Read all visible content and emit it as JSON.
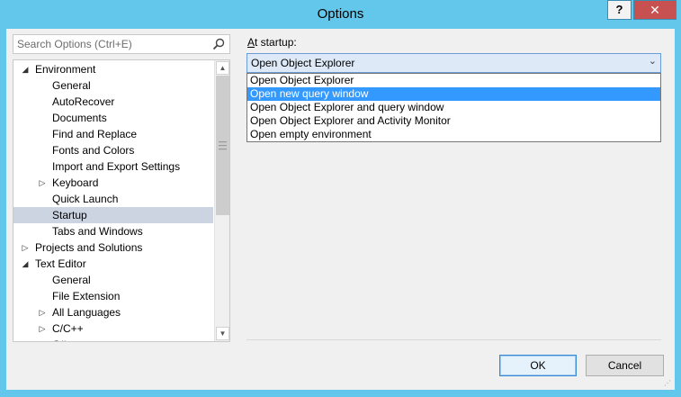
{
  "window": {
    "title": "Options",
    "help_label": "?",
    "close_label": "✕"
  },
  "search": {
    "placeholder": "Search Options (Ctrl+E)",
    "icon": "search-icon"
  },
  "tree": {
    "items": [
      {
        "label": "Environment",
        "indent": 0,
        "expander": "expanded"
      },
      {
        "label": "General",
        "indent": 1,
        "expander": "none"
      },
      {
        "label": "AutoRecover",
        "indent": 1,
        "expander": "none"
      },
      {
        "label": "Documents",
        "indent": 1,
        "expander": "none"
      },
      {
        "label": "Find and Replace",
        "indent": 1,
        "expander": "none"
      },
      {
        "label": "Fonts and Colors",
        "indent": 1,
        "expander": "none"
      },
      {
        "label": "Import and Export Settings",
        "indent": 1,
        "expander": "none"
      },
      {
        "label": "Keyboard",
        "indent": 1,
        "expander": "collapsed"
      },
      {
        "label": "Quick Launch",
        "indent": 1,
        "expander": "none"
      },
      {
        "label": "Startup",
        "indent": 1,
        "expander": "none",
        "selected": true
      },
      {
        "label": "Tabs and Windows",
        "indent": 1,
        "expander": "none"
      },
      {
        "label": "Projects and Solutions",
        "indent": 0,
        "expander": "collapsed"
      },
      {
        "label": "Text Editor",
        "indent": 0,
        "expander": "expanded"
      },
      {
        "label": "General",
        "indent": 1,
        "expander": "none"
      },
      {
        "label": "File Extension",
        "indent": 1,
        "expander": "none"
      },
      {
        "label": "All Languages",
        "indent": 1,
        "expander": "collapsed"
      },
      {
        "label": "C/C++",
        "indent": 1,
        "expander": "collapsed"
      },
      {
        "label": "C#",
        "indent": 1,
        "expander": "collapsed"
      }
    ]
  },
  "startup": {
    "label_prefix": "A",
    "label_rest": "t startup:",
    "selected_value": "Open Object Explorer",
    "options": [
      {
        "label": "Open Object Explorer",
        "highlighted": false
      },
      {
        "label": "Open new query window",
        "highlighted": true
      },
      {
        "label": "Open Object Explorer and query window",
        "highlighted": false
      },
      {
        "label": "Open Object Explorer and Activity Monitor",
        "highlighted": false
      },
      {
        "label": "Open empty environment",
        "highlighted": false
      }
    ]
  },
  "buttons": {
    "ok": "OK",
    "cancel": "Cancel"
  },
  "colors": {
    "titlebar": "#62c7ea",
    "selection": "#3399ff",
    "tree_selection": "#ccd4e1",
    "close": "#c75050"
  }
}
